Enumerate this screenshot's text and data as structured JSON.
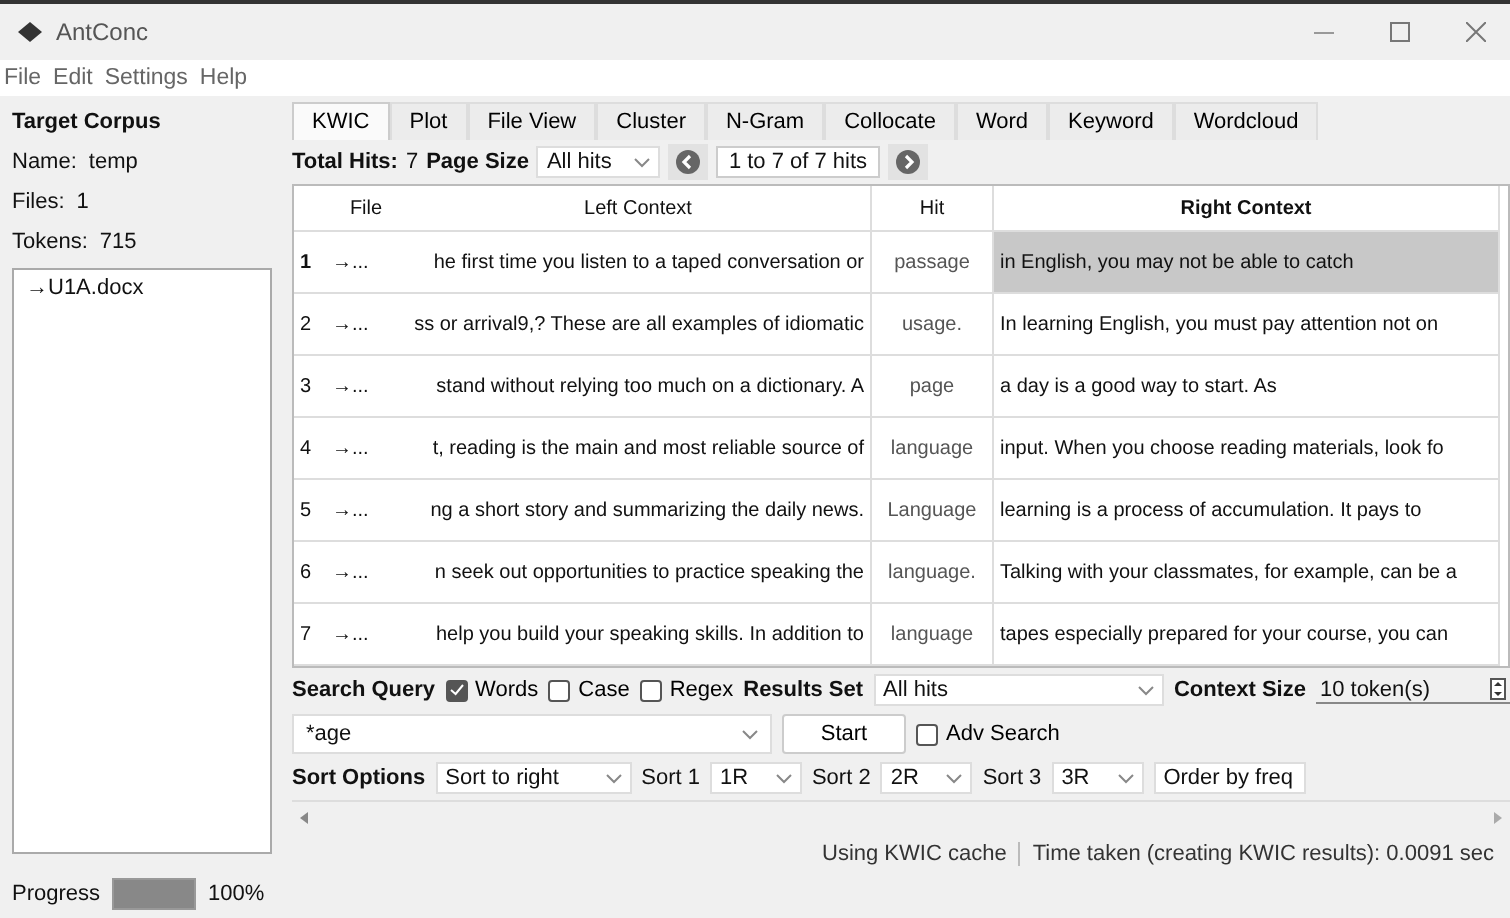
{
  "window": {
    "title": "AntConc"
  },
  "menu": [
    "File",
    "Edit",
    "Settings",
    "Help"
  ],
  "corpus": {
    "heading": "Target Corpus",
    "name_label": "Name:",
    "name": "temp",
    "files_label": "Files:",
    "files": "1",
    "tokens_label": "Tokens:",
    "tokens": "715",
    "file_list": [
      {
        "label": "→U1A.docx",
        "selected": false
      }
    ]
  },
  "progress": {
    "label": "Progress",
    "level": 1,
    "reading": "100%"
  },
  "tabs": [
    {
      "label": "KWIC",
      "selected": true
    },
    {
      "label": "Plot",
      "selected": false
    },
    {
      "label": "File View",
      "selected": false
    },
    {
      "label": "Cluster",
      "selected": false
    },
    {
      "label": "N-Gram",
      "selected": false
    },
    {
      "label": "Collocate",
      "selected": false
    },
    {
      "label": "Word",
      "selected": false
    },
    {
      "label": "Keyword",
      "selected": false
    },
    {
      "label": "Wordcloud",
      "selected": false
    }
  ],
  "hits": {
    "total_label": "Total Hits:",
    "total": "7",
    "page_size_label": "Page Size",
    "page_size": "All hits",
    "range": "1 to 7 of 7 hits"
  },
  "table": {
    "columns": [
      "File",
      "Left Context",
      "Hit",
      "Right Context"
    ],
    "rows": [
      {
        "num": "1",
        "file": "→...",
        "left": "he first time you listen to a taped conversation or",
        "hit": "passage",
        "right": "in English, you may not be able to catch",
        "selected": true
      },
      {
        "num": "2",
        "file": "→...",
        "left": "ss or arrival9,? These are all examples of idiomatic",
        "hit": "usage.",
        "right": "In learning English, you must pay attention not on",
        "selected": false
      },
      {
        "num": "3",
        "file": "→...",
        "left": "stand without relying too much on a dictionary. A",
        "hit": "page",
        "right": "a day is a good way to start. As",
        "selected": false
      },
      {
        "num": "4",
        "file": "→...",
        "left": "t, reading is the main and most reliable source of",
        "hit": "language",
        "right": "input. When you choose reading materials, look fo",
        "selected": false
      },
      {
        "num": "5",
        "file": "→...",
        "left": "ng a short story and summarizing the daily news.",
        "hit": "Language",
        "right": "learning is a process of accumulation. It pays to",
        "selected": false
      },
      {
        "num": "6",
        "file": "→...",
        "left": "n seek out opportunities to practice speaking the",
        "hit": "language.",
        "right": "Talking with your classmates, for example, can be a",
        "selected": false
      },
      {
        "num": "7",
        "file": "→...",
        "left": "help you build your speaking skills. In addition to",
        "hit": "language",
        "right": "tapes especially prepared for your course, you can",
        "selected": false
      }
    ]
  },
  "search": {
    "label": "Search Query",
    "options": [
      {
        "label": "Words",
        "checked": true
      },
      {
        "label": "Case",
        "checked": false
      },
      {
        "label": "Regex",
        "checked": false
      }
    ],
    "results_set_label": "Results Set",
    "results_set": "All hits",
    "context_size_label": "Context Size",
    "context_size": "10 token(s)",
    "query": "*age",
    "start": "Start",
    "adv_search": {
      "label": "Adv Search",
      "checked": false
    }
  },
  "sort": {
    "label": "Sort Options",
    "mode": "Sort to right",
    "sort1_label": "Sort 1",
    "sort1": "1R",
    "sort2_label": "Sort 2",
    "sort2": "2R",
    "sort3_label": "Sort 3",
    "sort3": "3R",
    "order": "Order by freq"
  },
  "status_bar": [
    "Using KWIC cache",
    "Time taken (creating KWIC results):  0.0091 sec"
  ]
}
